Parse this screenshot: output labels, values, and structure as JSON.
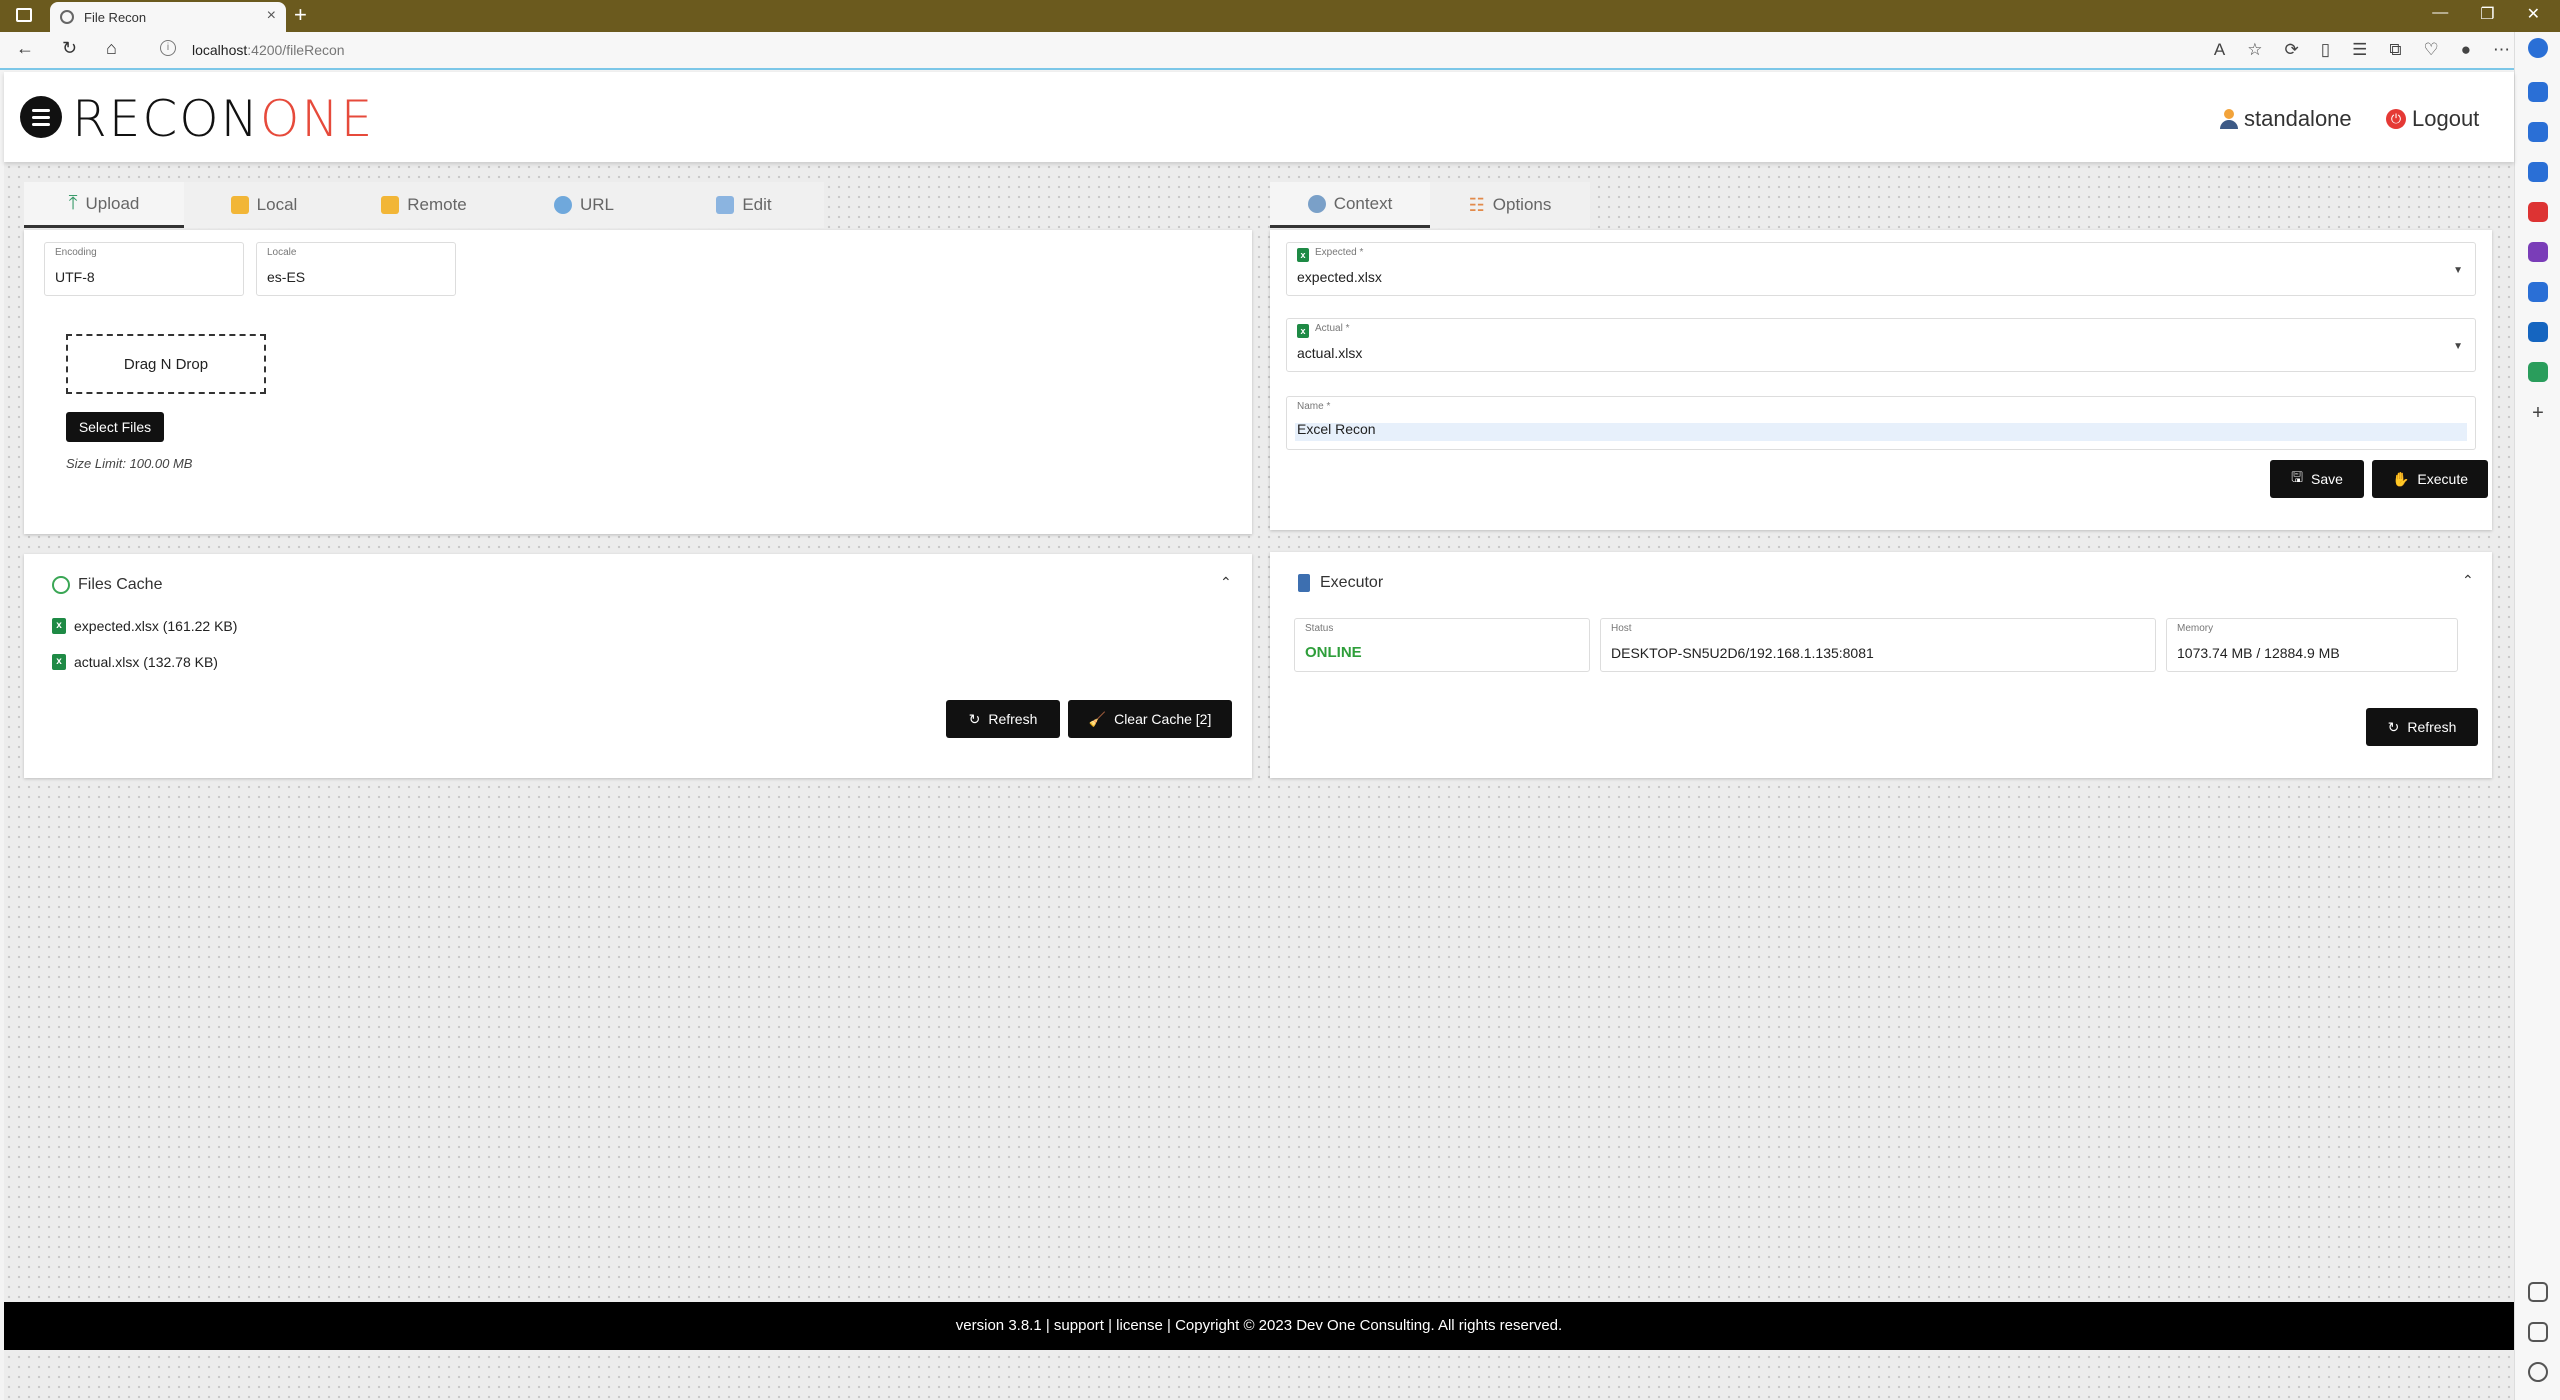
{
  "browser": {
    "tab_title": "File Recon",
    "url_host": "localhost",
    "url_rest": ":4200/fileRecon"
  },
  "header": {
    "logo_part1": "RECON",
    "logo_part2": "ONE",
    "user": "standalone",
    "logout": "Logout"
  },
  "left_tabs": [
    {
      "label": "Upload",
      "icon": "upload-icon"
    },
    {
      "label": "Local",
      "icon": "folder-icon"
    },
    {
      "label": "Remote",
      "icon": "remote-folder-icon"
    },
    {
      "label": "URL",
      "icon": "globe-icon"
    },
    {
      "label": "Edit",
      "icon": "edit-icon"
    }
  ],
  "upload": {
    "encoding_label": "Encoding",
    "encoding_value": "UTF-8",
    "locale_label": "Locale",
    "locale_value": "es-ES",
    "drop_label": "Drag N Drop",
    "select_files": "Select Files",
    "size_limit": "Size Limit: 100.00 MB"
  },
  "files_cache": {
    "title": "Files Cache",
    "files": [
      "expected.xlsx (161.22 KB)",
      "actual.xlsx (132.78 KB)"
    ],
    "refresh": "Refresh",
    "clear_cache": "Clear Cache [2]"
  },
  "right_tabs": [
    {
      "label": "Context",
      "icon": "gears-icon"
    },
    {
      "label": "Options",
      "icon": "sliders-icon"
    }
  ],
  "context": {
    "expected_label": "Expected *",
    "expected_value": "expected.xlsx",
    "actual_label": "Actual *",
    "actual_value": "actual.xlsx",
    "name_label": "Name *",
    "name_value": "Excel Recon",
    "save": "Save",
    "execute": "Execute"
  },
  "executor": {
    "title": "Executor",
    "status_label": "Status",
    "status_value": "ONLINE",
    "host_label": "Host",
    "host_value": "DESKTOP-SN5U2D6/192.168.1.135:8081",
    "memory_label": "Memory",
    "memory_value": "1073.74 MB / 12884.9 MB",
    "refresh": "Refresh"
  },
  "footer": {
    "text": "version 3.8.1 | support | license | Copyright © 2023 Dev One Consulting. All rights reserved."
  },
  "colors": {
    "titlebar": "#6b5a1e",
    "logo_accent": "#e64a3b",
    "online": "#2e9e3a",
    "excel_green": "#1e8a45"
  }
}
